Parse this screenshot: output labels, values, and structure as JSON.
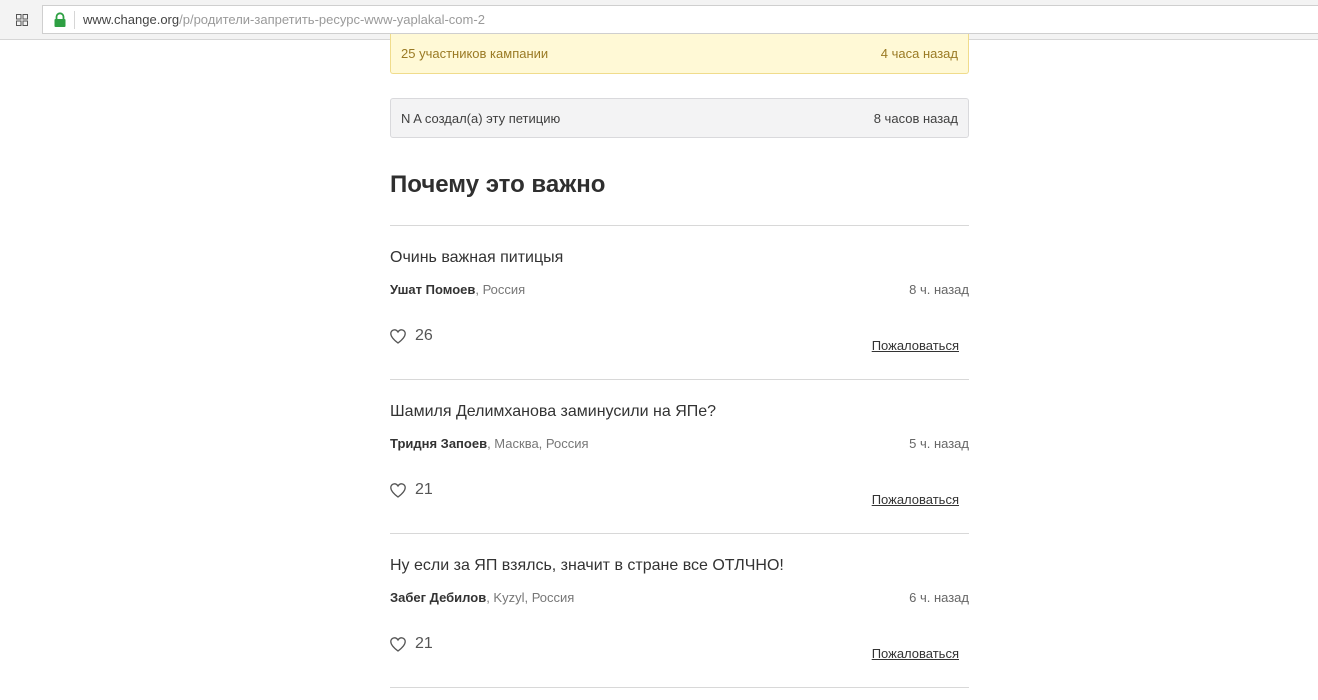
{
  "browser": {
    "url_domain": "www.change.org",
    "url_path": "/p/родители-запретить-ресурс-www-yaplakal-com-2"
  },
  "updates": {
    "supporters_label": "25 участников кампании",
    "supporters_time": "4 часа назад",
    "creator_label": "N A создал(а) эту петицию",
    "creator_time": "8 часов назад"
  },
  "section": {
    "heading": "Почему это важно"
  },
  "comments": [
    {
      "text": "Очинь важная питицыя",
      "author": "Ушат Помоев",
      "location": ", Россия",
      "time": "8 ч. назад",
      "likes": "26",
      "report": "Пожаловаться"
    },
    {
      "text": "Шамиля Делимханова заминусили на ЯПе?",
      "author": "Тридня Запоев",
      "location": ", Масква, Россия",
      "time": "5 ч. назад",
      "likes": "21",
      "report": "Пожаловаться"
    },
    {
      "text": "Ну если за ЯП взялсь, значит в стране все ОТЛЧНО!",
      "author": "Забег Дебилов",
      "location": ", Kyzyl, Россия",
      "time": "6 ч. назад",
      "likes": "21",
      "report": "Пожаловаться"
    }
  ],
  "colors": {
    "supporters_bg": "#fff9d6",
    "supporters_text": "#9a7a24",
    "creator_bg": "#f3f3f4",
    "lock_green": "#2ea043"
  }
}
